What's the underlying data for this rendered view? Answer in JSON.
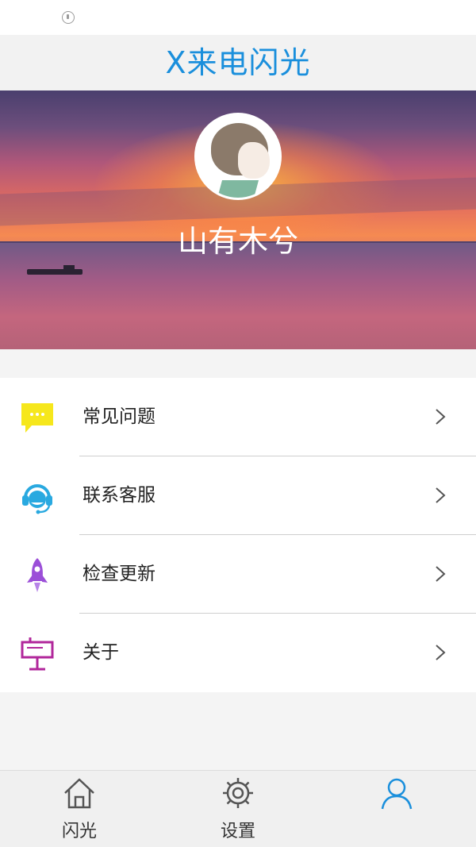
{
  "header": {
    "title": "X来电闪光"
  },
  "profile": {
    "name": "山有木兮"
  },
  "menu": {
    "items": [
      {
        "label": "常见问题",
        "icon": "chat-bubble-icon",
        "color": "#f6e71c"
      },
      {
        "label": "联系客服",
        "icon": "headset-icon",
        "color": "#29a9e0"
      },
      {
        "label": "检查更新",
        "icon": "rocket-icon",
        "color": "#9b4fd8"
      },
      {
        "label": "关于",
        "icon": "easel-icon",
        "color": "#b1279b"
      }
    ]
  },
  "tabbar": {
    "tabs": [
      {
        "label": "闪光",
        "icon": "home-icon"
      },
      {
        "label": "设置",
        "icon": "gear-icon"
      },
      {
        "label": "",
        "icon": "person-icon",
        "active": true
      }
    ],
    "active_color": "#1a8fdc"
  },
  "theme": {
    "accent": "#1a8fdc"
  }
}
